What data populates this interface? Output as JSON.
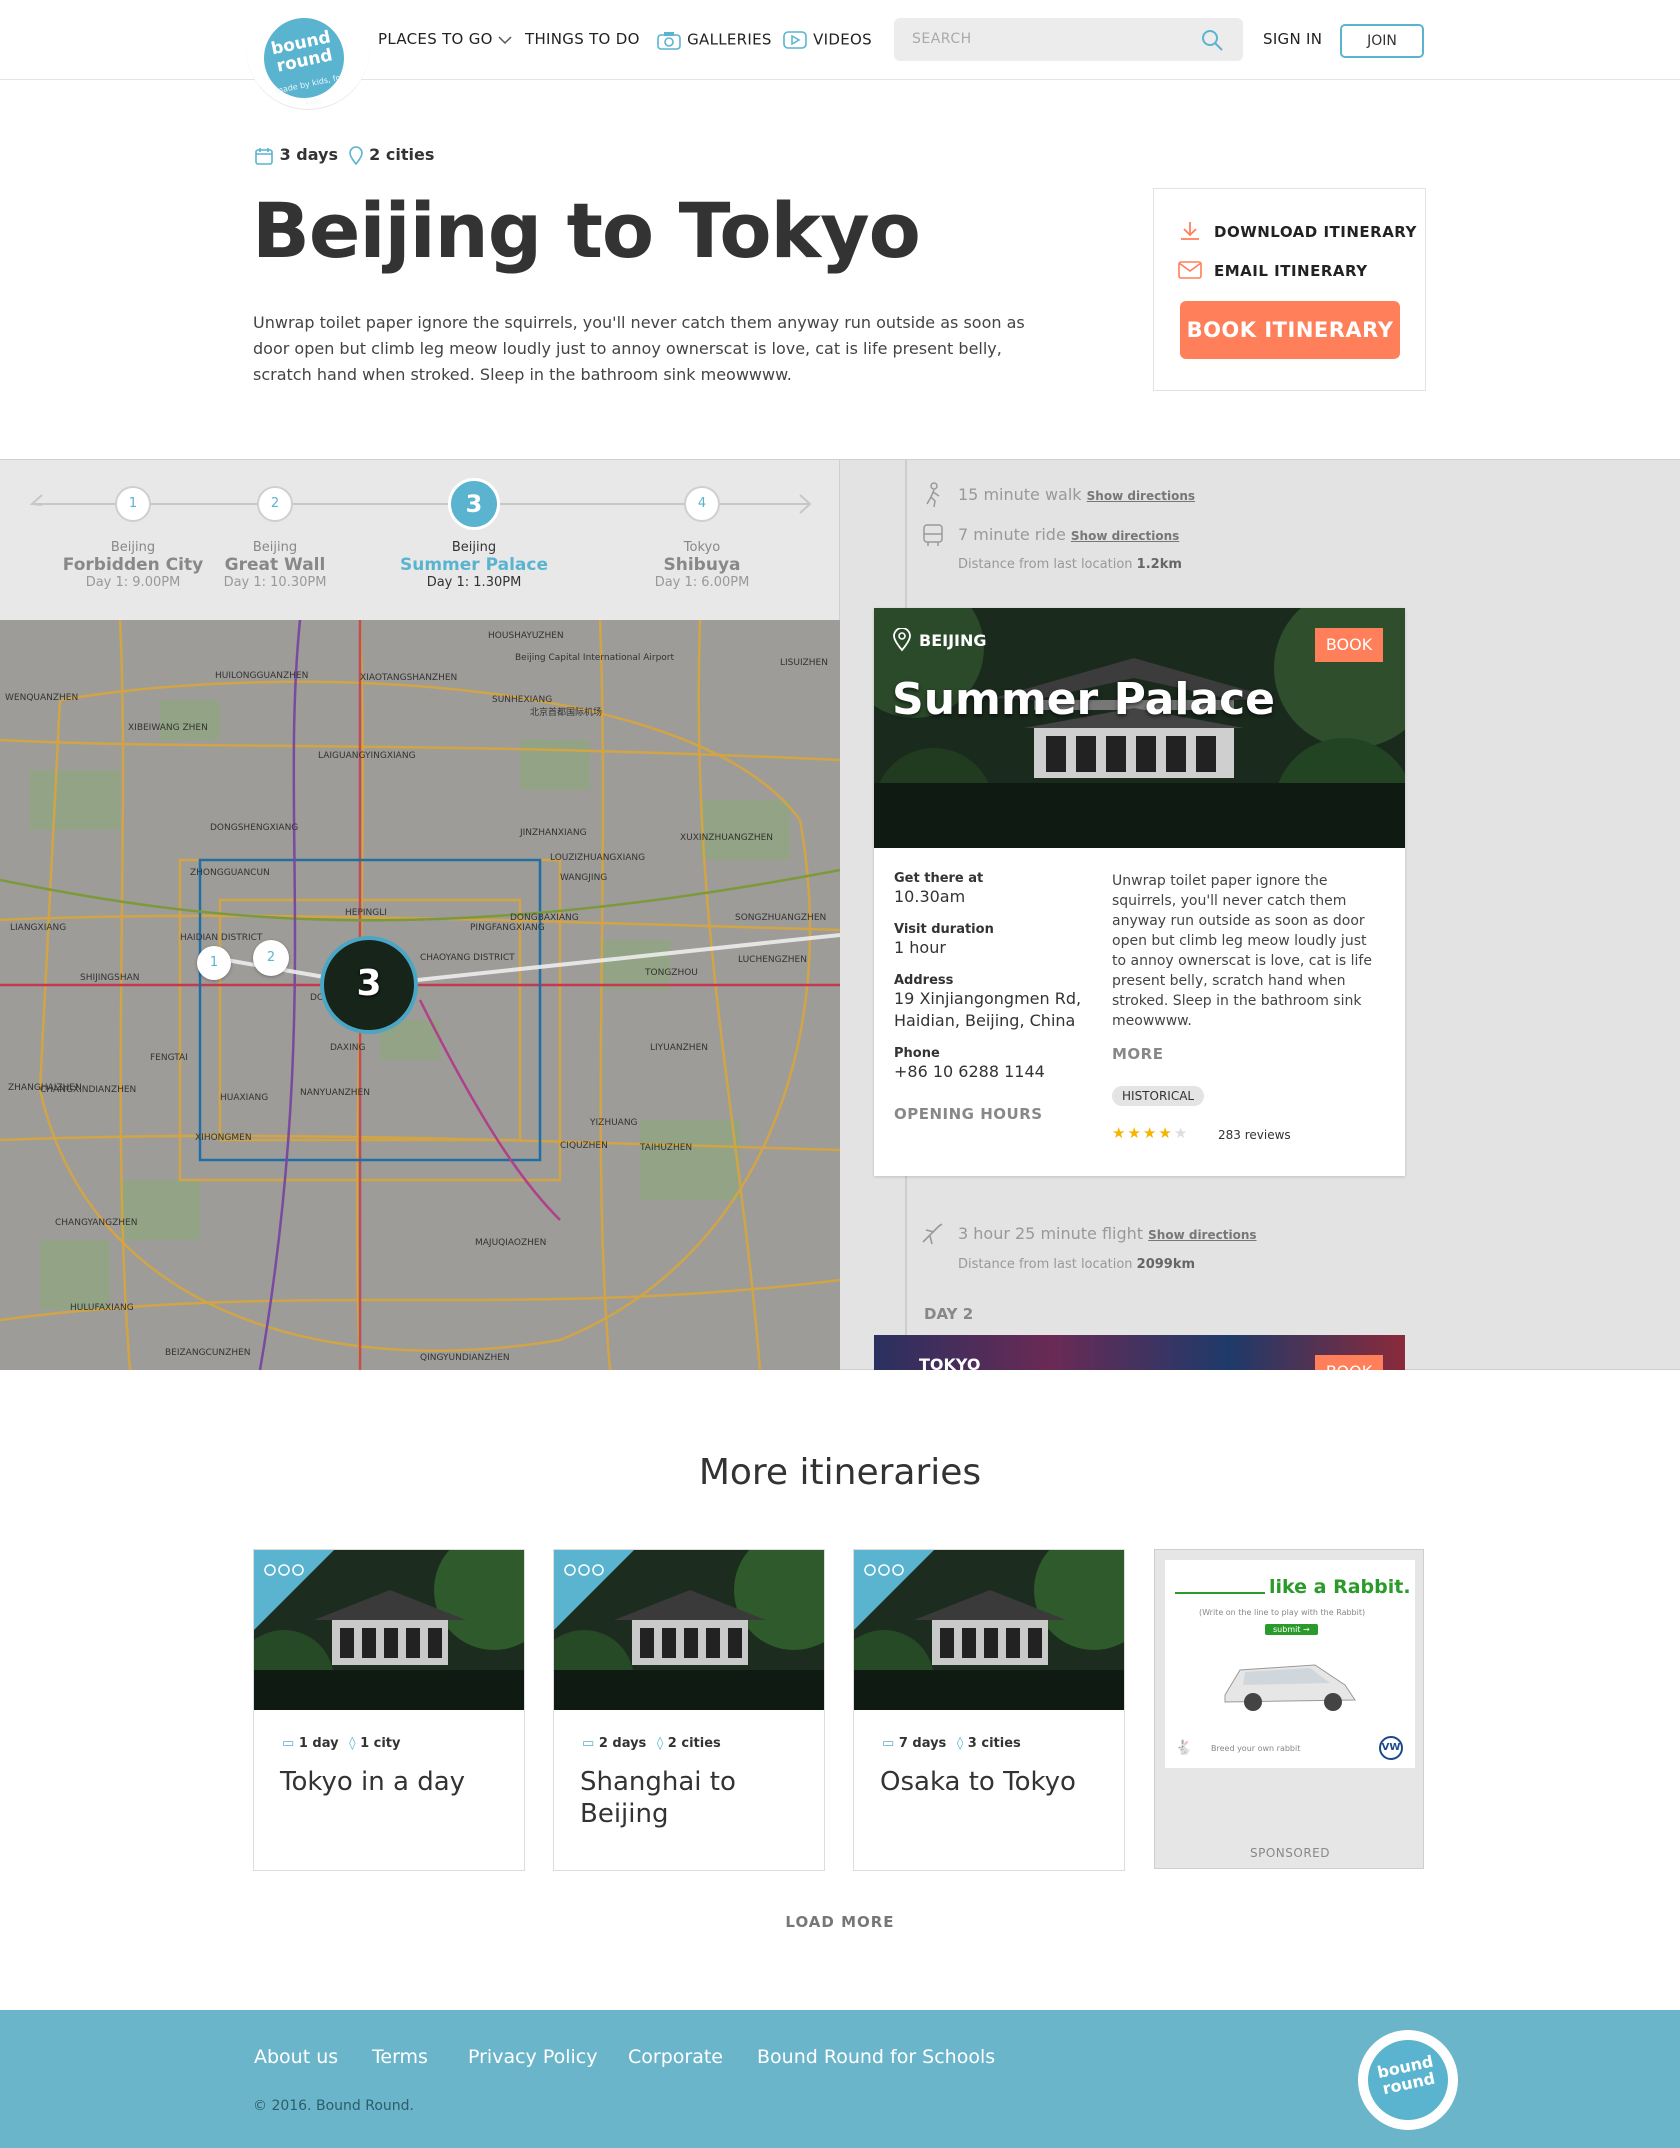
{
  "header": {
    "logo_text_1": "bound",
    "logo_text_2": "round",
    "logo_tagline": "made by kids, for kids",
    "nav": {
      "places": "PLACES TO GO",
      "things": "THINGS TO DO",
      "galleries": "GALLERIES",
      "videos": "VIDEOS"
    },
    "search_placeholder": "SEARCH",
    "sign_in": "SIGN IN",
    "join": "JOIN"
  },
  "intro": {
    "days": "3 days",
    "cities": "2 cities",
    "title": "Beijing to Tokyo",
    "description": "Unwrap toilet paper ignore the squirrels, you'll never catch them anyway run outside as soon as door open but climb leg meow loudly just to annoy ownerscat is love, cat is life present belly, scratch hand when stroked. Sleep in the bathroom sink meowwww."
  },
  "actions": {
    "download": "DOWNLOAD ITINERARY",
    "email": "EMAIL ITINERARY",
    "book": "BOOK ITINERARY"
  },
  "steps": [
    {
      "num": "1",
      "city": "Beijing",
      "name": "Forbidden City",
      "time": "Day 1: 9.00PM"
    },
    {
      "num": "2",
      "city": "Beijing",
      "name": "Great Wall",
      "time": "Day 1: 10.30PM"
    },
    {
      "num": "3",
      "city": "Beijing",
      "name": "Summer Palace",
      "time": "Day 1: 1.30PM"
    },
    {
      "num": "4",
      "city": "Tokyo",
      "name": "Shibuya",
      "time": "Day 1: 6.00PM"
    }
  ],
  "map": {
    "labels": [
      "HOUSHAYUZHEN",
      "Beijing Capital International Airport",
      "北京首都国际机场",
      "HUILONGGUANZHEN",
      "XIBEIWANG ZHEN",
      "LAIGUANGYINGXIANG",
      "SUNHEXIANG",
      "XIAOTANGSHANZHEN",
      "WENQUANZHEN",
      "DONGSHENGXIANG",
      "ZHONGGUANCUN",
      "XUXINZHUANGZHEN",
      "WANGJING",
      "DONGBAXIANG",
      "JINZHANXIANG",
      "LOUZIZHUANGXIANG",
      "HAIDIAN DISTRICT",
      "HEPINGLI",
      "CHAOYANG DISTRICT",
      "PINGFANGXIANG",
      "DONGCHENG",
      "TONGZHOU",
      "SHIJINGSHAN",
      "LIANGXIANG",
      "FENGTAI",
      "DAXING",
      "XIHONGMEN",
      "LIYUANZHEN",
      "TAIHUZHEN",
      "YIZHUANG",
      "ZHANGHAIZHEN",
      "MAJUQIAOZHEN",
      "QINGYUNDIANZHEN",
      "BEIZANGCUNZHEN",
      "HULUFAXIANG",
      "CHANGYANGZHEN",
      "CIQUZHEN",
      "NANYUANZHEN",
      "HUAXIANG",
      "CHANGXINDIANZHEN",
      "SONGZHUANGZHEN",
      "LUCHENGZHEN",
      "LISUIZHEN"
    ],
    "pin3": "3",
    "pin2": "2",
    "pin1": "1"
  },
  "transit_top": {
    "walk": "15 minute walk",
    "ride": "7 minute ride",
    "show": "Show directions",
    "distance_label": "Distance from last location",
    "distance": "1.2km"
  },
  "card": {
    "city": "BEIJING",
    "book": "BOOK",
    "title": "Summer Palace",
    "get_there_label": "Get there at",
    "get_there": "10.30am",
    "duration_label": "Visit duration",
    "duration": "1 hour",
    "address_label": "Address",
    "address": "19 Xinjiangongmen Rd, Haidian, Beijing, China",
    "phone_label": "Phone",
    "phone": "+86 10 6288 1144",
    "opening": "OPENING HOURS",
    "description": "Unwrap toilet paper ignore the squirrels, you'll never catch them anyway run outside as soon as door open but climb leg meow loudly just to annoy ownerscat is love, cat is life present belly, scratch hand when stroked. Sleep in the bathroom sink meowwww.",
    "more": "MORE",
    "tag": "HISTORICAL",
    "rating": 4,
    "reviews": "283 reviews"
  },
  "transit_bottom": {
    "flight": "3 hour 25 minute flight",
    "show": "Show directions",
    "distance_label": "Distance from last location",
    "distance": "2099km"
  },
  "day2": {
    "label": "DAY 2",
    "city": "TOKYO",
    "book": "BOOK"
  },
  "more": {
    "title": "More itineraries",
    "cards": [
      {
        "days": "1 day",
        "cities": "1 city",
        "title": "Tokyo in a day"
      },
      {
        "days": "2 days",
        "cities": "2 cities",
        "title": "Shanghai to Beijing"
      },
      {
        "days": "7 days",
        "cities": "3 cities",
        "title": "Osaka to Tokyo"
      }
    ],
    "ad": {
      "headline": "like a Rabbit.",
      "sub": "(Write on the line to play with the Rabbit)",
      "submit": "submit →",
      "foot": "Breed your own rabbit",
      "sponsored": "SPONSORED"
    },
    "load_more": "LOAD MORE"
  },
  "footer": {
    "links": [
      "About us",
      "Terms",
      "Privacy Policy",
      "Corporate",
      "Bound Round for Schools"
    ],
    "copyright": "© 2016. Bound Round."
  },
  "colors": {
    "accent": "#5ab4cf",
    "book": "#ff7f5a",
    "footer": "#6bb5cb"
  }
}
